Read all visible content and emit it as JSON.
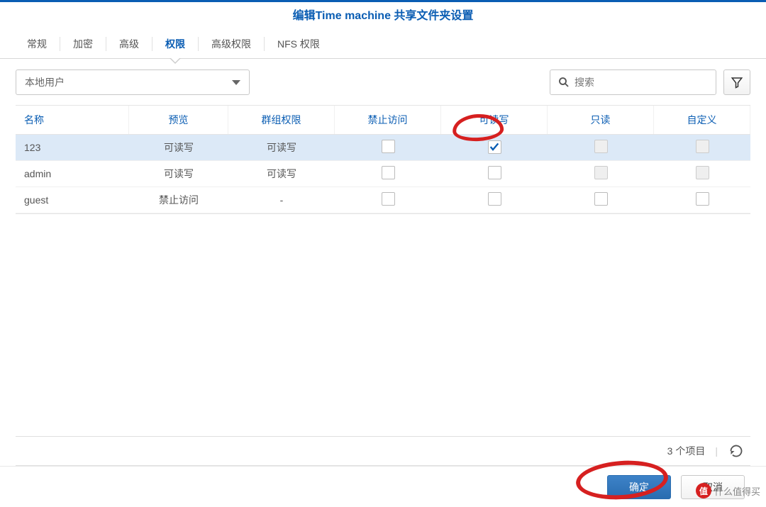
{
  "dialog": {
    "title": "编辑Time machine 共享文件夹设置"
  },
  "tabs": {
    "items": [
      {
        "label": "常规"
      },
      {
        "label": "加密"
      },
      {
        "label": "高级"
      },
      {
        "label": "权限",
        "active": true
      },
      {
        "label": "高级权限"
      },
      {
        "label": "NFS 权限"
      }
    ]
  },
  "toolbar": {
    "user_type_selected": "本地用户",
    "search_placeholder": "搜索"
  },
  "grid": {
    "columns": {
      "name": "名称",
      "preview": "预览",
      "group": "群组权限",
      "deny": "禁止访问",
      "rw": "可读写",
      "ro": "只读",
      "custom": "自定义"
    },
    "rows": [
      {
        "name": "123",
        "preview": "可读写",
        "preview_class": "perm-rw",
        "group": "可读写",
        "deny": false,
        "rw": true,
        "ro_disabled": true,
        "custom_disabled": true,
        "selected": true
      },
      {
        "name": "admin",
        "preview": "可读写",
        "preview_class": "perm-rw",
        "group": "可读写",
        "deny": false,
        "rw": false,
        "ro_disabled": true,
        "custom_disabled": true,
        "selected": false
      },
      {
        "name": "guest",
        "preview": "禁止访问",
        "preview_class": "perm-deny",
        "group": "-",
        "deny": false,
        "rw": false,
        "ro_disabled": false,
        "custom_disabled": false,
        "selected": false
      }
    ]
  },
  "status": {
    "count_text": "3 个项目"
  },
  "footer": {
    "ok_label": "确定",
    "cancel_label": "取消"
  },
  "watermark": {
    "badge": "值",
    "text": "什么值得买"
  }
}
